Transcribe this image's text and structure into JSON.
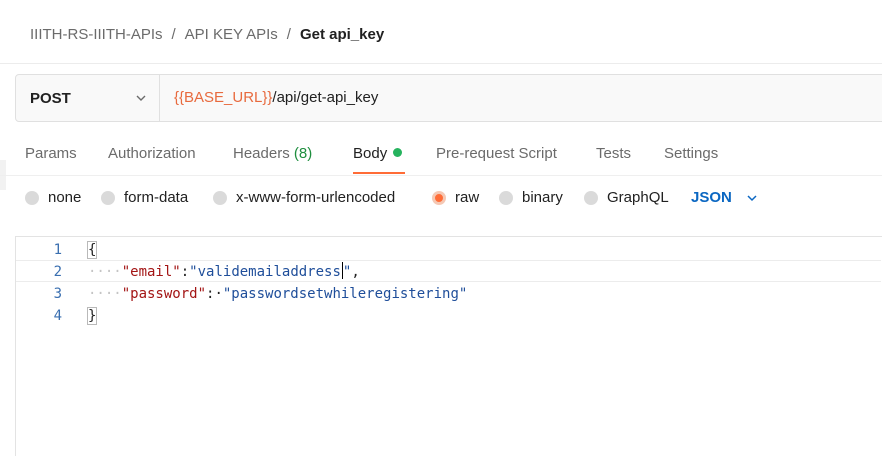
{
  "breadcrumb": {
    "items": [
      "IIITH-RS-IIITH-APIs",
      "API KEY APIs"
    ],
    "separator": "/",
    "current": "Get api_key"
  },
  "request": {
    "method": "POST",
    "url_variable": "{{BASE_URL}}",
    "url_path": "/api/get-api_key"
  },
  "tabs": {
    "params": "Params",
    "authorization": "Authorization",
    "headers": "Headers",
    "headers_count": "(8)",
    "body": "Body",
    "pre_request": "Pre-request Script",
    "tests": "Tests",
    "settings": "Settings"
  },
  "body_types": {
    "none": "none",
    "form_data": "form-data",
    "urlencoded": "x-www-form-urlencoded",
    "raw": "raw",
    "binary": "binary",
    "graphql": "GraphQL",
    "selected": "raw",
    "format": "JSON"
  },
  "editor": {
    "line_numbers": [
      "1",
      "2",
      "3",
      "4"
    ],
    "indent": "····",
    "open_brace": "{",
    "close_brace": "}",
    "line2_key": "\"email\"",
    "line2_sep": ":",
    "line2_value_a": "\"validemailaddress",
    "line2_value_b": "\"",
    "line2_end": ",",
    "line3_key": "\"password\"",
    "line3_sep": ":·",
    "line3_value": "\"passwordsetwhileregistering\""
  },
  "colors": {
    "accent": "#ff6c37",
    "variable": "#e86a3e",
    "link": "#0b67c2",
    "status_green": "#26b35e"
  }
}
